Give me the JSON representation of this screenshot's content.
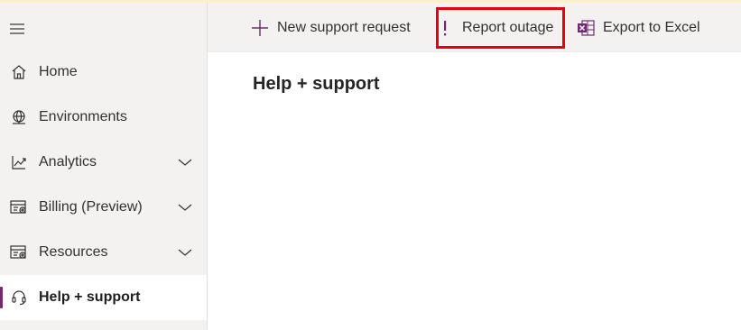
{
  "sidebar": {
    "items": [
      {
        "label": "Home",
        "icon": "home-icon"
      },
      {
        "label": "Environments",
        "icon": "globe-icon"
      },
      {
        "label": "Analytics",
        "icon": "analytics-icon",
        "expandable": true
      },
      {
        "label": "Billing (Preview)",
        "icon": "billing-icon",
        "expandable": true
      },
      {
        "label": "Resources",
        "icon": "resources-icon",
        "expandable": true
      },
      {
        "label": "Help + support",
        "icon": "headset-icon",
        "selected": true
      }
    ]
  },
  "commandbar": {
    "new_request_label": "New support request",
    "report_outage_label": "Report outage",
    "export_label": "Export to Excel"
  },
  "main": {
    "title": "Help + support"
  },
  "colors": {
    "accent": "#742774",
    "excel": "#217346",
    "highlight": "#e3000f",
    "sidebar_bg": "#f3f2f1"
  }
}
